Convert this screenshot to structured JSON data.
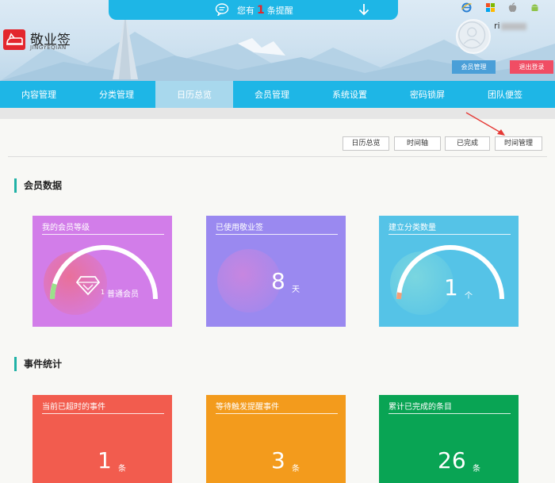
{
  "notice": {
    "prefix": "您有",
    "count": "1",
    "suffix": "条提醒"
  },
  "logo": {
    "title": "敬业签",
    "subtitle": "JINGYEQIAN"
  },
  "user": {
    "name": "ri",
    "member_btn": "会员管理",
    "logout_btn": "退出登录"
  },
  "platforms": [
    "ie-icon",
    "windows-icon",
    "apple-icon",
    "android-icon"
  ],
  "nav": [
    "内容管理",
    "分类管理",
    "日历总览",
    "会员管理",
    "系统设置",
    "密码锁屏",
    "团队便签"
  ],
  "nav_active": "日历总览",
  "tabs": [
    "日历总览",
    "时间轴",
    "已完成",
    "时间管理"
  ],
  "sections": {
    "member": "会员数据",
    "events": "事件统计"
  },
  "member_cards": [
    {
      "title": "我的会员等级",
      "value": "1",
      "unit": "普通会员",
      "color": "#d27de9"
    },
    {
      "title": "已使用敬业签",
      "value": "8",
      "unit": "天",
      "color": "#9a89f0"
    },
    {
      "title": "建立分类数量",
      "value": "1",
      "unit": "个",
      "color": "#55c3e7"
    }
  ],
  "event_cards": [
    {
      "title": "当前已超时的事件",
      "value": "1",
      "unit": "条",
      "color": "#f25c4e"
    },
    {
      "title": "等待触发提醒事件",
      "value": "3",
      "unit": "条",
      "color": "#f39b1c"
    },
    {
      "title": "累计已完成的条目",
      "value": "26",
      "unit": "条",
      "color": "#09a454"
    }
  ],
  "colors": {
    "primary": "#1eb6e6",
    "logout": "#f04d64",
    "member_btn": "#4a9fd8",
    "accent": "#20b2a6"
  }
}
